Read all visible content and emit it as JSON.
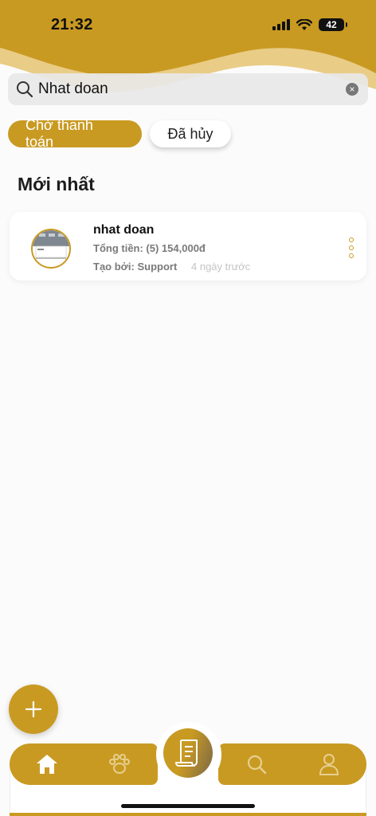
{
  "status": {
    "time": "21:32",
    "battery": "42"
  },
  "search": {
    "value": "Nhat doan",
    "clear_label": "×"
  },
  "tabs": [
    {
      "label": "Chờ thanh toán",
      "active": true
    },
    {
      "label": "Đã hủy",
      "active": false
    }
  ],
  "section": {
    "title": "Mới nhất"
  },
  "orders": [
    {
      "name": "nhat doan",
      "total": "Tổng tiền: (5) 154,000đ",
      "creator": "Tạo bởi: Support",
      "time": "4 ngày trước"
    }
  ],
  "icons": {
    "search": "search-icon",
    "clear": "close-icon",
    "menu": "more-vertical-icon",
    "fab": "plus-icon",
    "home": "home-icon",
    "pet": "paw-icon",
    "receipt": "receipt-icon",
    "search_nav": "search-icon",
    "profile": "user-icon"
  },
  "colors": {
    "accent": "#c99a22",
    "background": "#fbfbfb",
    "muted_text": "#7a7a7a"
  }
}
